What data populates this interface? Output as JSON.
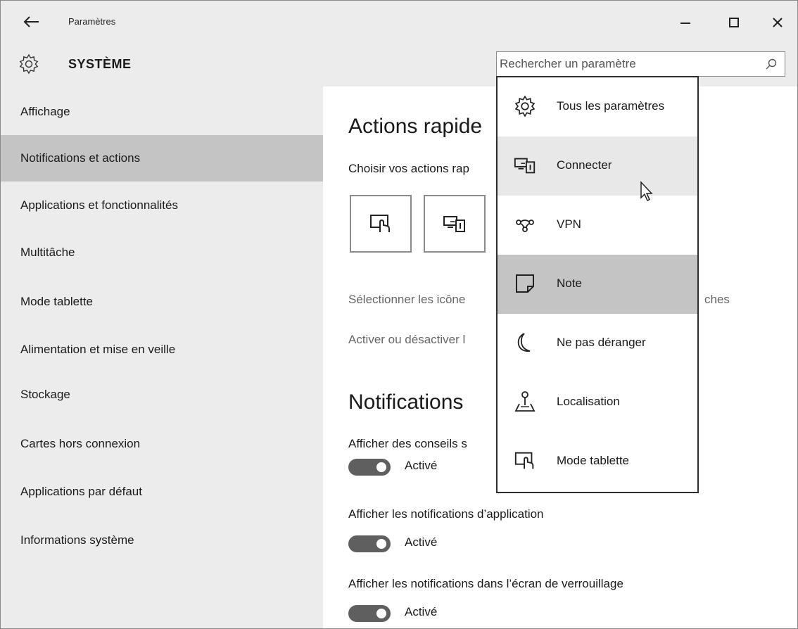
{
  "window": {
    "title": "Paramètres",
    "controls": {
      "minimize_icon": "minimize-icon",
      "maximize_icon": "maximize-icon",
      "close_icon": "close-icon"
    }
  },
  "header": {
    "section_title": "SYSTÈME",
    "search": {
      "placeholder": "Rechercher un paramètre",
      "icon": "search-icon"
    }
  },
  "sidebar": {
    "items": [
      {
        "label": "Affichage",
        "selected": false
      },
      {
        "label": "Notifications et actions",
        "selected": true
      },
      {
        "label": "Applications et fonctionnalités",
        "selected": false
      },
      {
        "label": "Multitâche",
        "selected": false
      },
      {
        "label": "Mode tablette",
        "selected": false
      },
      {
        "label": "Alimentation et mise en veille",
        "selected": false
      },
      {
        "label": "Stockage",
        "selected": false
      },
      {
        "label": "Cartes hors connexion",
        "selected": false
      },
      {
        "label": "Applications par défaut",
        "selected": false
      },
      {
        "label": "Informations système",
        "selected": false
      }
    ]
  },
  "main": {
    "quick_actions_heading": "Actions rapide",
    "quick_actions_subtitle": "Choisir vos actions rap",
    "quick_tiles": [
      {
        "icon": "tablet-mode-icon"
      },
      {
        "icon": "connect-icon"
      }
    ],
    "link_select_icons": "Sélectionner les icône",
    "link_select_icons_tail": "ches",
    "link_toggle_icons": "Activer ou désactiver l",
    "notifications_heading": "Notifications",
    "settings": [
      {
        "label": "Afficher des conseils s",
        "state": "Activé",
        "on": true
      },
      {
        "label": "Afficher les notifications d’application",
        "state": "Activé",
        "on": true
      },
      {
        "label": "Afficher les notifications dans l’écran de verrouillage",
        "state": "Activé",
        "on": true
      }
    ]
  },
  "dropdown": {
    "items": [
      {
        "label": "Tous les paramètres",
        "icon": "gear-icon",
        "state": "normal"
      },
      {
        "label": "Connecter",
        "icon": "connect-icon",
        "state": "hover"
      },
      {
        "label": "VPN",
        "icon": "vpn-icon",
        "state": "normal"
      },
      {
        "label": "Note",
        "icon": "note-icon",
        "state": "selected"
      },
      {
        "label": "Ne pas déranger",
        "icon": "moon-icon",
        "state": "normal"
      },
      {
        "label": "Localisation",
        "icon": "location-icon",
        "state": "normal"
      },
      {
        "label": "Mode tablette",
        "icon": "tablet-mode-icon",
        "state": "normal"
      }
    ]
  }
}
